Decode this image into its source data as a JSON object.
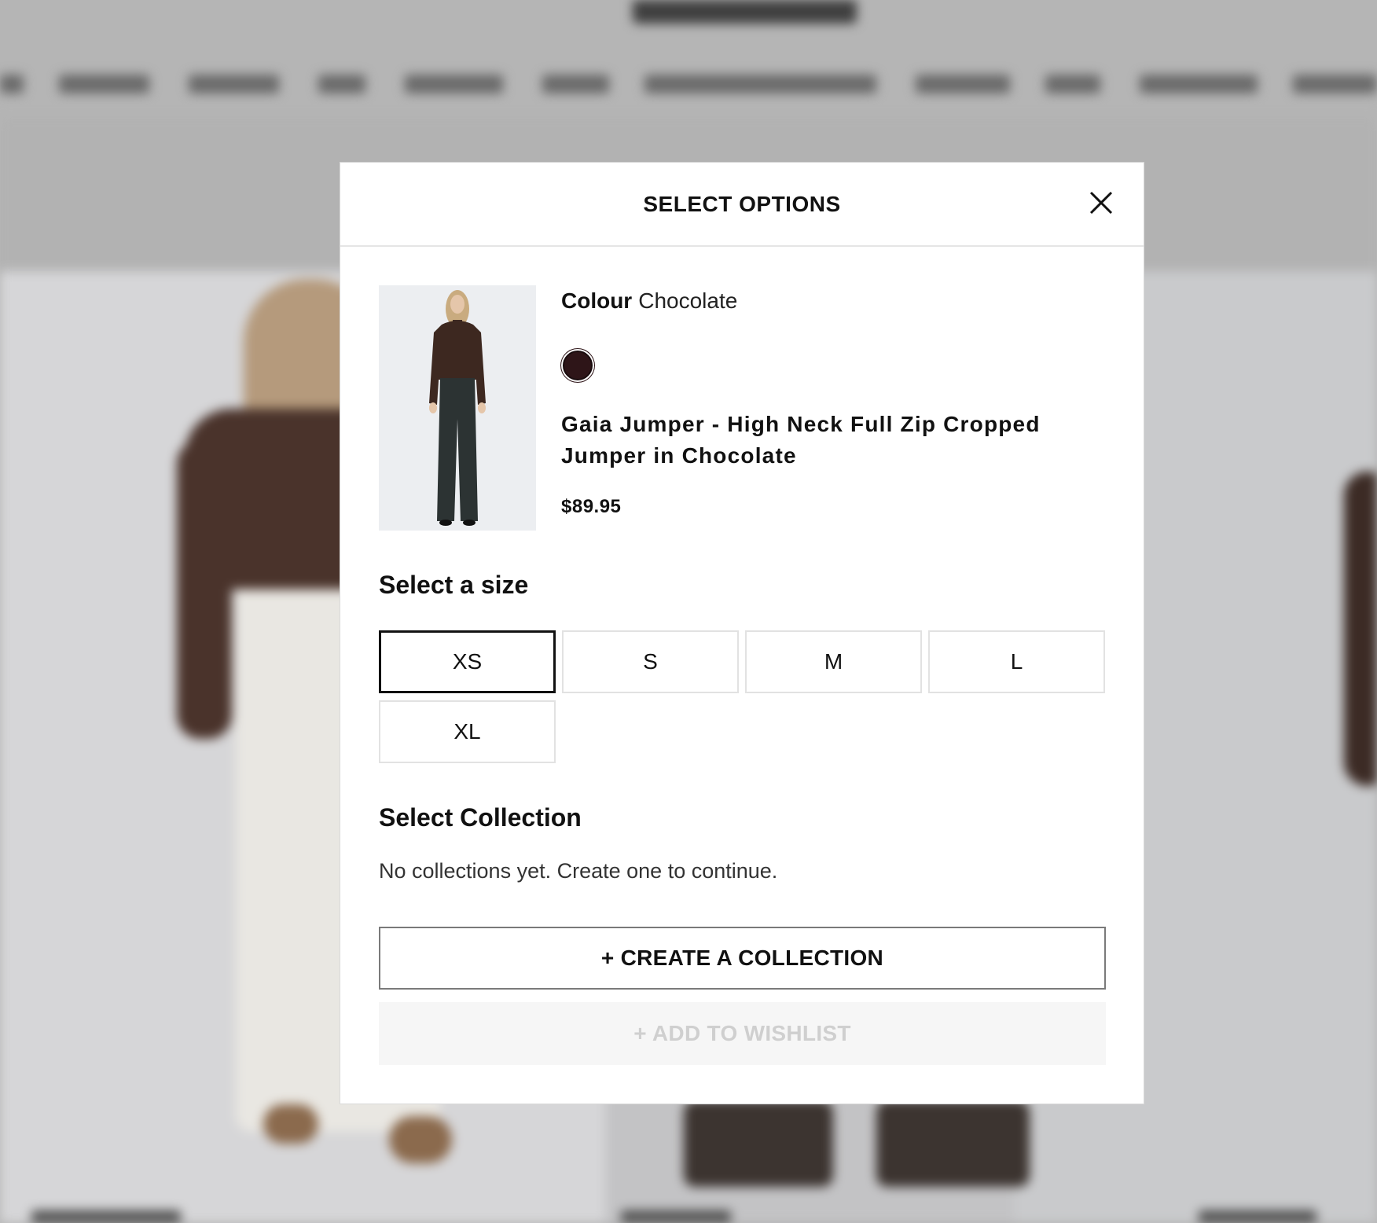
{
  "modal": {
    "title": "SELECT OPTIONS",
    "close_icon": "close-icon"
  },
  "product": {
    "colour_label": "Colour",
    "colour_value": "Chocolate",
    "swatch_color": "#2e1518",
    "name": "Gaia Jumper - High Neck Full Zip Cropped Jumper in Chocolate",
    "price": "$89.95"
  },
  "size_section": {
    "heading": "Select a size",
    "selected": "XS",
    "sizes": [
      "XS",
      "S",
      "M",
      "L",
      "XL"
    ]
  },
  "collection_section": {
    "heading": "Select Collection",
    "empty_message": "No collections yet. Create one to continue.",
    "create_label": "+ CREATE A COLLECTION",
    "wishlist_label": "+ ADD TO WISHLIST"
  }
}
